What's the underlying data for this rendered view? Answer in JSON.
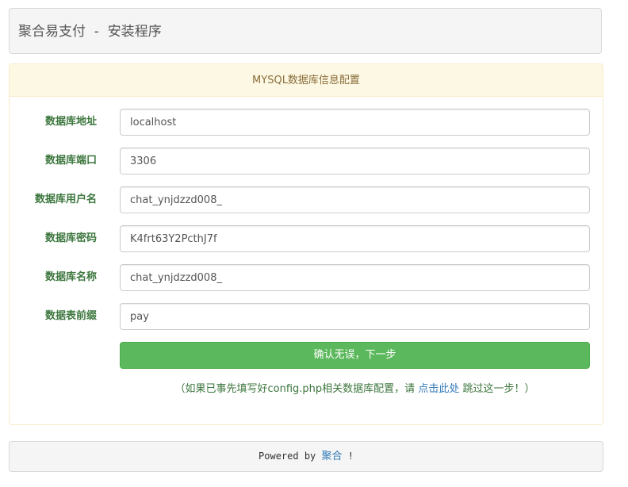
{
  "navbar": {
    "brand": "聚合易支付  -  安装程序"
  },
  "panel": {
    "heading": "MYSQL数据库信息配置",
    "fields": [
      {
        "label": "数据库地址",
        "value": "localhost"
      },
      {
        "label": "数据库端口",
        "value": "3306"
      },
      {
        "label": "数据库用户名",
        "value": "chat_ynjdzzd008_"
      },
      {
        "label": "数据库密码",
        "value": "K4frt63Y2PcthJ7f"
      },
      {
        "label": "数据库名称",
        "value": "chat_ynjdzzd008_"
      },
      {
        "label": "数据表前缀",
        "value": "pay"
      }
    ],
    "submit_label": "确认无误，下一步",
    "hint_prefix": "（如果已事先填写好config.php相关数据库配置，请 ",
    "hint_link": "点击此处",
    "hint_suffix": " 跳过这一步！）"
  },
  "footer": {
    "prefix": "Powered by ",
    "link": "聚合",
    "suffix": " !"
  }
}
